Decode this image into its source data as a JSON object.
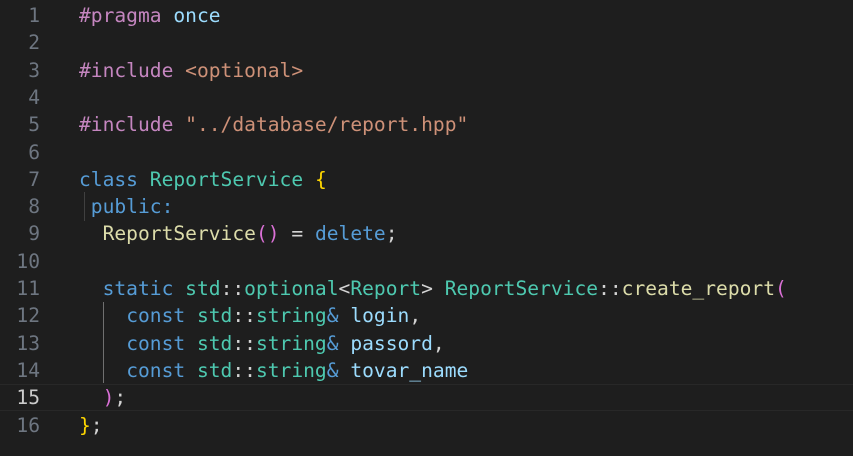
{
  "editor": {
    "current_line": 15,
    "colors": {
      "background": "#1e1e1e",
      "line_number": "#6e7681",
      "line_number_active": "#cccccc",
      "directive": "#c586c0",
      "include_path": "#ce9178",
      "keyword": "#569cd6",
      "type": "#4ec9b0",
      "function": "#dcdcaa",
      "variable": "#9cdcfe",
      "plain": "#d4d4d4",
      "bracket_gold": "#ffd700",
      "bracket_purple": "#da70d6",
      "bracket_blue": "#179fff"
    },
    "lines": [
      {
        "num": "1",
        "tokens": [
          {
            "t": "#pragma",
            "c": "directive"
          },
          {
            "t": " ",
            "c": "plain"
          },
          {
            "t": "once",
            "c": "variable"
          }
        ]
      },
      {
        "num": "2",
        "tokens": []
      },
      {
        "num": "3",
        "tokens": [
          {
            "t": "#include",
            "c": "directive"
          },
          {
            "t": " ",
            "c": "plain"
          },
          {
            "t": "<optional>",
            "c": "include_path"
          }
        ]
      },
      {
        "num": "4",
        "tokens": []
      },
      {
        "num": "5",
        "tokens": [
          {
            "t": "#include",
            "c": "directive"
          },
          {
            "t": " ",
            "c": "plain"
          },
          {
            "t": "\"../database/report.hpp\"",
            "c": "include_path"
          }
        ]
      },
      {
        "num": "6",
        "tokens": []
      },
      {
        "num": "7",
        "tokens": [
          {
            "t": "class",
            "c": "keyword"
          },
          {
            "t": " ",
            "c": "plain"
          },
          {
            "t": "ReportService",
            "c": "type"
          },
          {
            "t": " ",
            "c": "plain"
          },
          {
            "t": "{",
            "c": "bracket_gold"
          }
        ]
      },
      {
        "num": "8",
        "tokens": [
          {
            "t": " ",
            "c": "plain"
          },
          {
            "t": "public",
            "c": "keyword"
          },
          {
            "t": ":",
            "c": "keyword"
          }
        ]
      },
      {
        "num": "9",
        "tokens": [
          {
            "t": "  ",
            "c": "plain"
          },
          {
            "t": "ReportService",
            "c": "function"
          },
          {
            "t": "()",
            "c": "bracket_purple"
          },
          {
            "t": " = ",
            "c": "plain"
          },
          {
            "t": "delete",
            "c": "keyword"
          },
          {
            "t": ";",
            "c": "plain"
          }
        ]
      },
      {
        "num": "10",
        "tokens": []
      },
      {
        "num": "11",
        "tokens": [
          {
            "t": "  ",
            "c": "plain"
          },
          {
            "t": "static",
            "c": "keyword"
          },
          {
            "t": " ",
            "c": "plain"
          },
          {
            "t": "std",
            "c": "type"
          },
          {
            "t": "::",
            "c": "plain"
          },
          {
            "t": "optional",
            "c": "type"
          },
          {
            "t": "<",
            "c": "plain"
          },
          {
            "t": "Report",
            "c": "type"
          },
          {
            "t": "> ",
            "c": "plain"
          },
          {
            "t": "ReportService",
            "c": "type"
          },
          {
            "t": "::",
            "c": "plain"
          },
          {
            "t": "create_report",
            "c": "function"
          },
          {
            "t": "(",
            "c": "bracket_purple"
          }
        ]
      },
      {
        "num": "12",
        "tokens": [
          {
            "t": "    ",
            "c": "plain"
          },
          {
            "t": "const",
            "c": "keyword"
          },
          {
            "t": " ",
            "c": "plain"
          },
          {
            "t": "std",
            "c": "type"
          },
          {
            "t": "::",
            "c": "plain"
          },
          {
            "t": "string",
            "c": "type"
          },
          {
            "t": "&",
            "c": "keyword"
          },
          {
            "t": " ",
            "c": "plain"
          },
          {
            "t": "login",
            "c": "variable"
          },
          {
            "t": ",",
            "c": "plain"
          }
        ]
      },
      {
        "num": "13",
        "tokens": [
          {
            "t": "    ",
            "c": "plain"
          },
          {
            "t": "const",
            "c": "keyword"
          },
          {
            "t": " ",
            "c": "plain"
          },
          {
            "t": "std",
            "c": "type"
          },
          {
            "t": "::",
            "c": "plain"
          },
          {
            "t": "string",
            "c": "type"
          },
          {
            "t": "&",
            "c": "keyword"
          },
          {
            "t": " ",
            "c": "plain"
          },
          {
            "t": "passord",
            "c": "variable"
          },
          {
            "t": ",",
            "c": "plain"
          }
        ]
      },
      {
        "num": "14",
        "tokens": [
          {
            "t": "    ",
            "c": "plain"
          },
          {
            "t": "const",
            "c": "keyword"
          },
          {
            "t": " ",
            "c": "plain"
          },
          {
            "t": "std",
            "c": "type"
          },
          {
            "t": "::",
            "c": "plain"
          },
          {
            "t": "string",
            "c": "type"
          },
          {
            "t": "&",
            "c": "keyword"
          },
          {
            "t": " ",
            "c": "plain"
          },
          {
            "t": "tovar_name",
            "c": "variable"
          }
        ]
      },
      {
        "num": "15",
        "tokens": [
          {
            "t": "  ",
            "c": "plain"
          },
          {
            "t": ")",
            "c": "bracket_purple"
          },
          {
            "t": ";",
            "c": "plain"
          }
        ]
      },
      {
        "num": "16",
        "tokens": [
          {
            "t": "}",
            "c": "bracket_gold"
          },
          {
            "t": ";",
            "c": "plain"
          }
        ]
      }
    ]
  }
}
